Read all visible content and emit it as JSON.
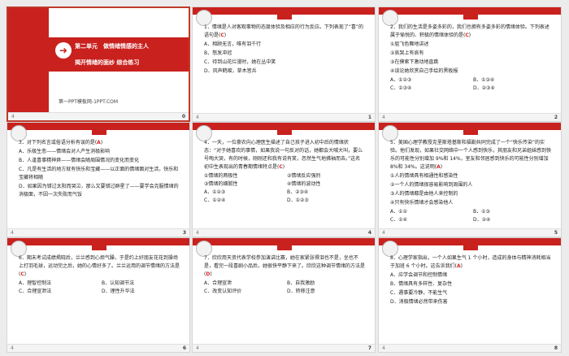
{
  "slides": [
    {
      "num": "0",
      "footer": "4",
      "unit": "第二单元　做情绪情感的主人",
      "topic": "揭开情绪的面纱 综合练习",
      "site": "第一PPT模板网-1PPT.COM"
    },
    {
      "num": "1",
      "footer": "4",
      "q": "1．情绪是人对客观事物的态度体验及相应的行为反应。下列表现了“喜”的语句是(",
      "ans": "C",
      "qend": ")",
      "opts": [
        "A．相顾无言，唯有泪千行",
        "B．怒发冲冠",
        "C．待到山花烂漫时，她在丛中笑",
        "D．风声鹤唳，草木皆兵"
      ]
    },
    {
      "num": "2",
      "footer": "4",
      "q": "2．我们的生活是多姿多彩的，我们也拥有多姿多彩的情绪体验。下列表述属于愉悦的、积极的情绪体验的是(",
      "ans": "C",
      "qend": ")",
      "items": [
        "①屈飞色舞地讲述",
        "②哀哭上有哀有",
        "③在摸索下激动地直跳",
        "④谈论她欣赏自己手绘的黑板报"
      ],
      "opts": [
        "A．①②③",
        "B．①③④",
        "C．①③④",
        "D．②③④"
      ]
    },
    {
      "num": "3",
      "footer": "4",
      "q": "3．对下列名言或俗语分析有误的是(",
      "ans": "A",
      "qend": ")",
      "lines": [
        "A．乐极生悲——情绪会对人产生消极影响",
        "B．人逢喜事精神爽——情绪会随周围情况的变化而变化",
        "C．凡是有生活的地方就有快乐和宝藏——以正面的情绪面对生活，快乐和宝藏将相随",
        "D．如果因为错过太阳而哭泣，那么又要错过群星了——要学会克服情绪的消极面，不因一次失败而气馁"
      ]
    },
    {
      "num": "4",
      "footer": "4",
      "q": "4．一天，一位豪农向心理医生描述了自己孩子进入初中后的情绪状态：“对于她喜欢的事情，如果我说一句反对的话，她都会大喊大叫，要么号啕大哭，有的时候，刚刚还和我有说有笑，忽然生气地拂袖而去。”这名初中生表现出的青春期情绪特点是(",
      "ans": "C",
      "qend": ")",
      "items": [
        "①情绪的两极性",
        "②情绪反应强烈",
        "③情绪的细腻性",
        "④情绪的波动性"
      ],
      "opts": [
        "A．①②③",
        "B．②③④",
        "C．①②④",
        "D．①②③"
      ]
    },
    {
      "num": "5",
      "footer": "4",
      "q": "5．美国心理学教授克里斯塔基斯和福勒共同完成了一个“快乐传染”的实验。他们发现，如果社交网络中一个人感到快乐，其朋友和兄弟姐妹感到快乐的可能性分别增加 9%和 14%，室友和邻居感到快乐的可能性分别增加 8%和 34%。这说明(",
      "ans": "A",
      "qend": ")",
      "items": [
        "①人的情绪具有相通性和感染性",
        "②一个人的情绪很容易影响到周围的人",
        "③人的情绪都是由他人来控制的",
        "④只有快乐情绪才会感染他人"
      ],
      "opts": [
        "A．①②",
        "B．①③",
        "C．①④",
        "D．②④"
      ]
    },
    {
      "num": "6",
      "footer": "4",
      "q": "6．期末考试成绩揭晓后，兰兰感到心烦气躁，于是约上好朋友花花到操场上打羽毛球，运动完之后，她的心情好多了。兰兰运用的调节情绪的方法是(",
      "ans": "C",
      "qend": ")",
      "opts": [
        "A．理智控制法",
        "B．认知调节法",
        "C．合理宣泄法",
        "D．理性升华法"
      ]
    },
    {
      "num": "7",
      "footer": "4",
      "q": "7．欣欣用天资代表学校参加演讲比赛，她在家紧张得泪也不是，坐也不是，看完一段喜剧小品后，她很快平静下来了。欣欣这种调节情绪的方法是(",
      "ans": "D",
      "qend": ")",
      "opts": [
        "A．合理宣泄",
        "B．自我激励",
        "C．改变认知评价",
        "D．转移注意"
      ]
    },
    {
      "num": "8",
      "footer": "4",
      "q": "8．心理学家指出，一个人如果生气 1 个小时，造成的身体与精神消耗相当于加班 6 个小时。这告诉我们(",
      "ans": "A",
      "qend": ")",
      "lines": [
        "A．应学会调节和控制情绪",
        "B．情绪具有多样性、复杂性",
        "C．遇事要冷静，不能生气",
        "D．消极情绪必然带来伤害"
      ]
    }
  ]
}
